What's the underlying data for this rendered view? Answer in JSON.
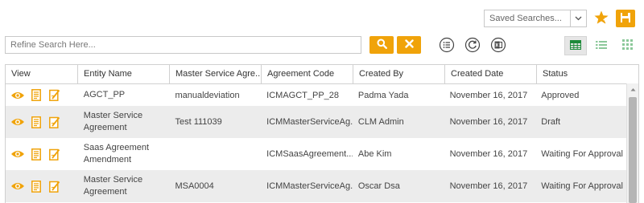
{
  "toolbar": {
    "saved_searches": "Saved Searches...",
    "star_icon": "star-icon",
    "save_icon": "save-icon"
  },
  "search": {
    "placeholder": "Refine Search Here...",
    "value": ""
  },
  "colors": {
    "accent": "#f0a30a",
    "grid_view_active": "#1e8a3a",
    "view_inactive": "#8cc89a",
    "alt_row": "#ececec"
  },
  "grid": {
    "columns": [
      "View",
      "Entity Name",
      "Master Service Agre...",
      "Agreement Code",
      "Created By",
      "Created Date",
      "Status"
    ],
    "rows": [
      {
        "entity": "AGCT_PP",
        "msa": "manualdeviation",
        "code": "ICMAGCT_PP_28",
        "created_by": "Padma Yada",
        "created_date": "November 16, 2017",
        "status": "Approved"
      },
      {
        "entity": "Master Service Agreement",
        "msa": "Test 111039",
        "code": "ICMMasterServiceAg...",
        "created_by": "CLM Admin",
        "created_date": "November 16, 2017",
        "status": "Draft"
      },
      {
        "entity": "Saas Agreement Amendment",
        "msa": "",
        "code": "ICMSaasAgreement...",
        "created_by": "Abe Kim",
        "created_date": "November 16, 2017",
        "status": "Waiting For Approval"
      },
      {
        "entity": "Master Service Agreement",
        "msa": "MSA0004",
        "code": "ICMMasterServiceAg...",
        "created_by": "Oscar Dsa",
        "created_date": "November 16, 2017",
        "status": "Waiting For Approval"
      }
    ]
  }
}
